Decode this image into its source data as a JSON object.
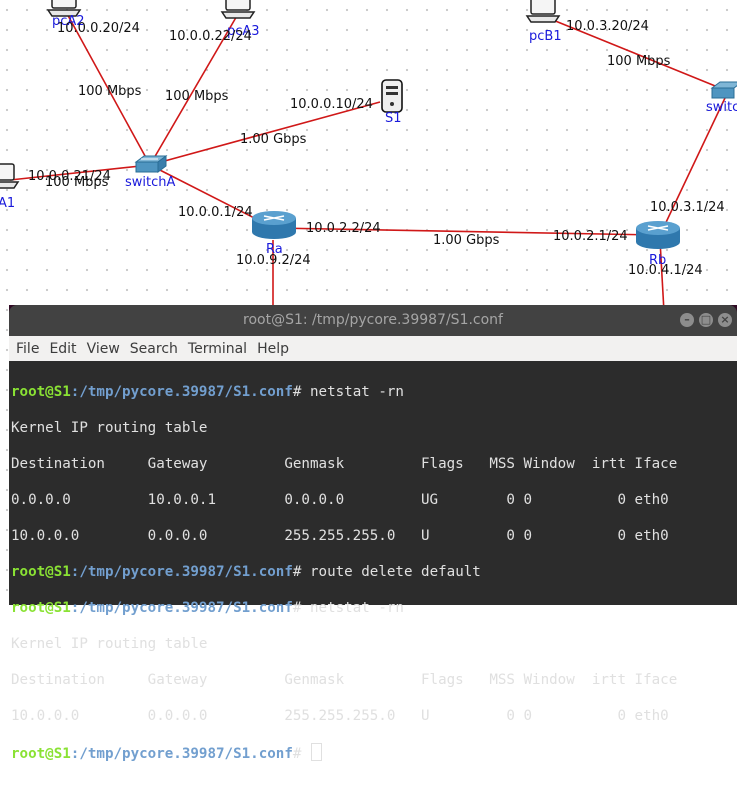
{
  "topology": {
    "nodes": {
      "pcA2": "pcA2",
      "pcA3": "pcA3",
      "pcB1": "pcB1",
      "S1": "S1",
      "switchA": "switchA",
      "switchB": "switc",
      "pcA1": "A1",
      "Ra": "Ra",
      "Rb": "Rb"
    },
    "labels": {
      "pcA2_ip": "10.0.0.20/24",
      "pcA3_ip": "10.0.0.22/24",
      "pcB1_ip": "10.0.3.20/24",
      "S1_ip": "10.0.0.10/24",
      "pcA1_ip": "10.0.0.21/24",
      "ra_a_ip": "10.0.0.1/24",
      "ra_b_ip": "10.0.2.2/24",
      "ra_c_ip": "10.0.9.2/24",
      "rb_a_ip": "10.0.2.1/24",
      "rb_b_ip": "10.0.3.1/24",
      "rb_c_ip": "10.0.4.1/24",
      "bw_pcA2": "100 Mbps",
      "bw_pcA3": "100 Mbps",
      "bw_S1": "1.00 Gbps",
      "bw_pcA1": "100 Mbps",
      "bw_ra_rb": "1.00 Gbps",
      "bw_pcB1": "100 Mbps"
    }
  },
  "terminal": {
    "title": "root@S1: /tmp/pycore.39987/S1.conf",
    "menu": [
      "File",
      "Edit",
      "View",
      "Search",
      "Terminal",
      "Help"
    ],
    "prompt_user": "root@S1",
    "prompt_path": ":/tmp/pycore.39987/S1.conf",
    "prompt_suffix": "# ",
    "cmd1": "netstat -rn",
    "cmd2": "route delete default",
    "cmd3": "netstat -rn",
    "table_title": "Kernel IP routing table",
    "table_header": "Destination     Gateway         Genmask         Flags   MSS Window  irtt Iface",
    "table1_rows": [
      "0.0.0.0         10.0.0.1        0.0.0.0         UG        0 0          0 eth0",
      "10.0.0.0        0.0.0.0         255.255.255.0   U         0 0          0 eth0"
    ],
    "table2_rows": [
      "10.0.0.0        0.0.0.0         255.255.255.0   U         0 0          0 eth0"
    ]
  }
}
